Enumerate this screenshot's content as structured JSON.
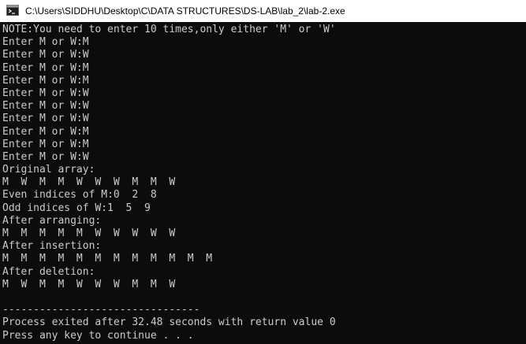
{
  "window": {
    "title": "C:\\Users\\SIDDHU\\Desktop\\C\\DATA STRUCTURES\\DS-LAB\\lab_2\\lab-2.exe",
    "icon": "console-app-icon"
  },
  "console": {
    "lines": [
      "NOTE:You need to enter 10 times,only either 'M' or 'W'",
      "Enter M or W:M",
      "Enter M or W:W",
      "Enter M or W:M",
      "Enter M or W:M",
      "Enter M or W:W",
      "Enter M or W:W",
      "Enter M or W:W",
      "Enter M or W:M",
      "Enter M or W:M",
      "Enter M or W:W",
      "Original array:",
      "M  W  M  M  W  W  W  M  M  W",
      "Even indices of M:0  2  8",
      "Odd indices of W:1  5  9",
      "After arranging:",
      "M  M  M  M  M  W  W  W  W  W",
      "After insertion:",
      "M  M  M  M  M  M  M  M  M  M  M  M",
      "After deletion:",
      "M  W  M  M  W  W  W  M  M  W",
      "",
      "--------------------------------",
      "Process exited after 32.48 seconds with return value 0",
      "Press any key to continue . . ."
    ]
  }
}
